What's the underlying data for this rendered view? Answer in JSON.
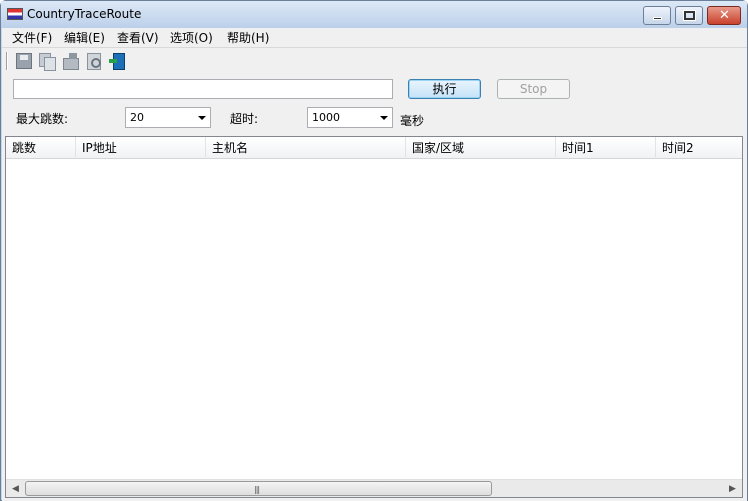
{
  "window": {
    "title": "CountryTraceRoute",
    "minimize_label": "",
    "close_label": "✕"
  },
  "menu": {
    "items": [
      {
        "label": "文件(F)"
      },
      {
        "label": "编辑(E)"
      },
      {
        "label": "查看(V)"
      },
      {
        "label": "选项(O)"
      },
      {
        "label": "帮助(H)"
      }
    ]
  },
  "toolbar": {
    "icons": [
      "save-icon",
      "copy-icon",
      "export-icon",
      "find-icon",
      "exit-icon"
    ]
  },
  "form": {
    "target_value": "",
    "execute_label": "执行",
    "stop_label": "Stop",
    "max_hops_label": "最大跳数:",
    "max_hops_value": "20",
    "timeout_label": "超时:",
    "timeout_value": "1000",
    "timeout_unit": "毫秒"
  },
  "list": {
    "columns": [
      {
        "label": "跳数"
      },
      {
        "label": "IP地址"
      },
      {
        "label": "主机名"
      },
      {
        "label": "国家/区域"
      },
      {
        "label": "时间1"
      },
      {
        "label": "时间2"
      }
    ],
    "rows": []
  },
  "scrollbar": {
    "left_arrow": "◀",
    "right_arrow": "▶",
    "grip": "|||"
  }
}
